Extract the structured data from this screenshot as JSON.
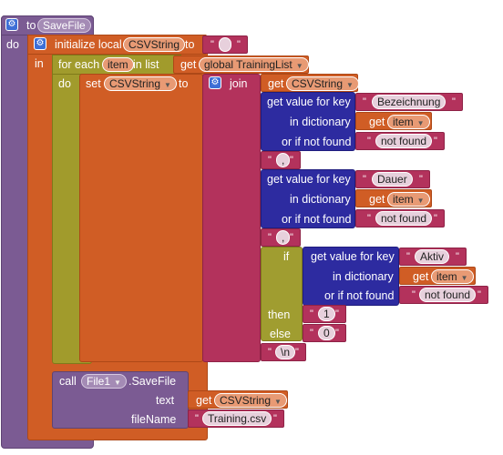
{
  "proc": {
    "to": "to",
    "name": "SaveFile",
    "do": "do"
  },
  "init": {
    "label": "initialize local",
    "var": "CSVString",
    "to": "to",
    "in": "in"
  },
  "loop": {
    "for_each": "for each",
    "var": "item",
    "in_list": "in list",
    "get": "get",
    "list": "global TrainingList",
    "do": "do"
  },
  "setblk": {
    "set": "set",
    "var": "CSVString",
    "to": "to"
  },
  "join": "join",
  "get_csv": {
    "get": "get",
    "var": "CSVString"
  },
  "d1": {
    "label": "get value for key",
    "key": "Bezeichnung",
    "in_dict": "in dictionary",
    "get": "get",
    "item": "item",
    "or_if": "or if not found",
    "nf": "not found"
  },
  "sep1": ",",
  "d2": {
    "label": "get value for key",
    "key": "Dauer",
    "in_dict": "in dictionary",
    "get": "get",
    "item": "item",
    "or_if": "or if not found",
    "nf": "not found"
  },
  "sep2": ",",
  "ifblk": {
    "if": "if",
    "label": "get value for key",
    "key": "Aktiv",
    "in_dict": "in dictionary",
    "get": "get",
    "item": "item",
    "or_if": "or if not found",
    "nf": "not found",
    "then": "then",
    "then_val": "1",
    "else": "else",
    "else_val": "0"
  },
  "nl": "\\n",
  "call": {
    "call": "call",
    "comp": "File1",
    "method": ".SaveFile",
    "text": "text",
    "get": "get",
    "var": "CSVString",
    "filename": "fileName",
    "fname_val": "Training.csv"
  },
  "colors": {
    "procedure": "#7b5b93",
    "local": "#d05d25",
    "control": "#a19b2c",
    "dictionary": "#2d2ba0",
    "text": "#b3325c"
  }
}
